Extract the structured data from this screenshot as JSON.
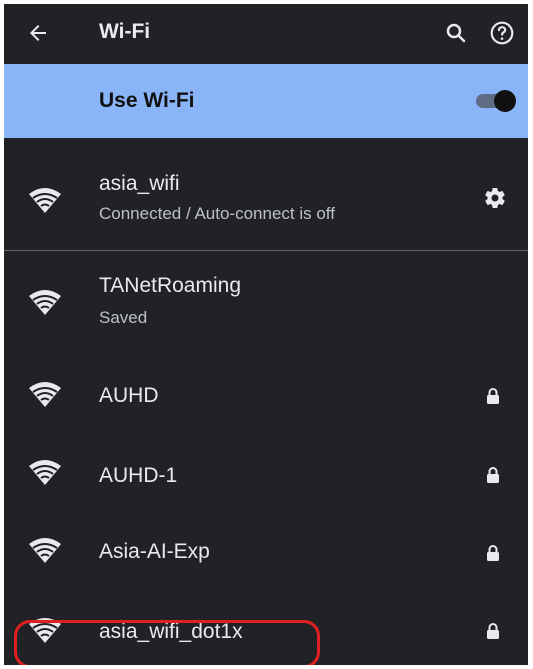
{
  "toolbar": {
    "title": "Wi-Fi"
  },
  "use_wifi": {
    "label": "Use Wi-Fi",
    "toggle_on": true
  },
  "networks": [
    {
      "name": "asia_wifi",
      "status": "Connected / Auto-connect is off",
      "secured": false,
      "settings": true
    },
    {
      "name": "TANetRoaming",
      "status": "Saved",
      "secured": false,
      "settings": false
    },
    {
      "name": "AUHD",
      "status": "",
      "secured": true,
      "settings": false
    },
    {
      "name": "AUHD-1",
      "status": "",
      "secured": true,
      "settings": false
    },
    {
      "name": "Asia-AI-Exp",
      "status": "",
      "secured": true,
      "settings": false
    },
    {
      "name": "asia_wifi_dot1x",
      "status": "",
      "secured": true,
      "settings": false
    }
  ],
  "colors": {
    "background": "#212226",
    "accent": "#8ab4f8",
    "annotation": "#e02020",
    "text_primary": "#e8eaed",
    "text_secondary": "#bdc1c6"
  },
  "icons": {
    "back": "arrow-back-icon",
    "search": "search-icon",
    "help": "help-icon",
    "wifi": "wifi-signal-icon",
    "lock": "lock-icon",
    "settings": "gear-icon"
  }
}
